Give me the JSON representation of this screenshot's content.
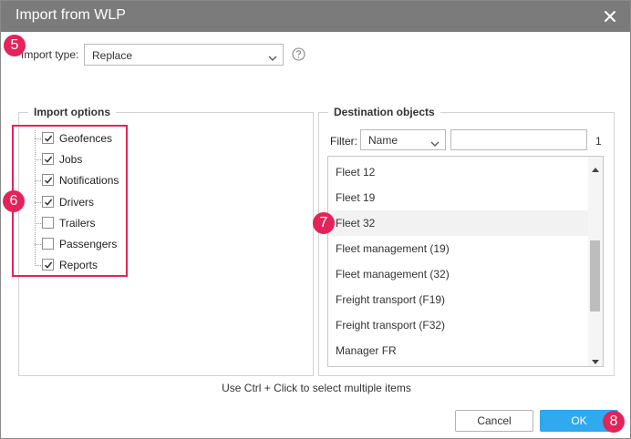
{
  "dialog": {
    "title": "Import from WLP",
    "close_icon": "close-icon"
  },
  "import_type": {
    "label": "Import type:",
    "value": "Replace",
    "help_icon": "question-icon"
  },
  "import_options": {
    "legend": "Import options",
    "items": [
      {
        "label": "Geofences",
        "checked": true
      },
      {
        "label": "Jobs",
        "checked": true
      },
      {
        "label": "Notifications",
        "checked": true
      },
      {
        "label": "Drivers",
        "checked": true
      },
      {
        "label": "Trailers",
        "checked": false
      },
      {
        "label": "Passengers",
        "checked": false
      },
      {
        "label": "Reports",
        "checked": true
      }
    ]
  },
  "destination": {
    "legend": "Destination objects",
    "filter_label": "Filter:",
    "filter_by": "Name",
    "filter_value": "",
    "count": "1",
    "items": [
      {
        "label": "Fleet 12",
        "highlighted": false
      },
      {
        "label": "Fleet 19",
        "highlighted": false
      },
      {
        "label": "Fleet 32",
        "highlighted": true
      },
      {
        "label": "Fleet management (19)",
        "highlighted": false
      },
      {
        "label": "Fleet management (32)",
        "highlighted": false
      },
      {
        "label": "Freight transport (F19)",
        "highlighted": false
      },
      {
        "label": "Freight transport (F32)",
        "highlighted": false
      },
      {
        "label": "Manager FR",
        "highlighted": false
      }
    ]
  },
  "hint": "Use Ctrl + Click to select multiple items",
  "buttons": {
    "cancel": "Cancel",
    "ok": "OK"
  },
  "callouts": [
    "5",
    "6",
    "7",
    "8"
  ],
  "colors": {
    "titlebar": "#7b7b7b",
    "callout": "#e2245a",
    "ok_button": "#30a9ee"
  }
}
